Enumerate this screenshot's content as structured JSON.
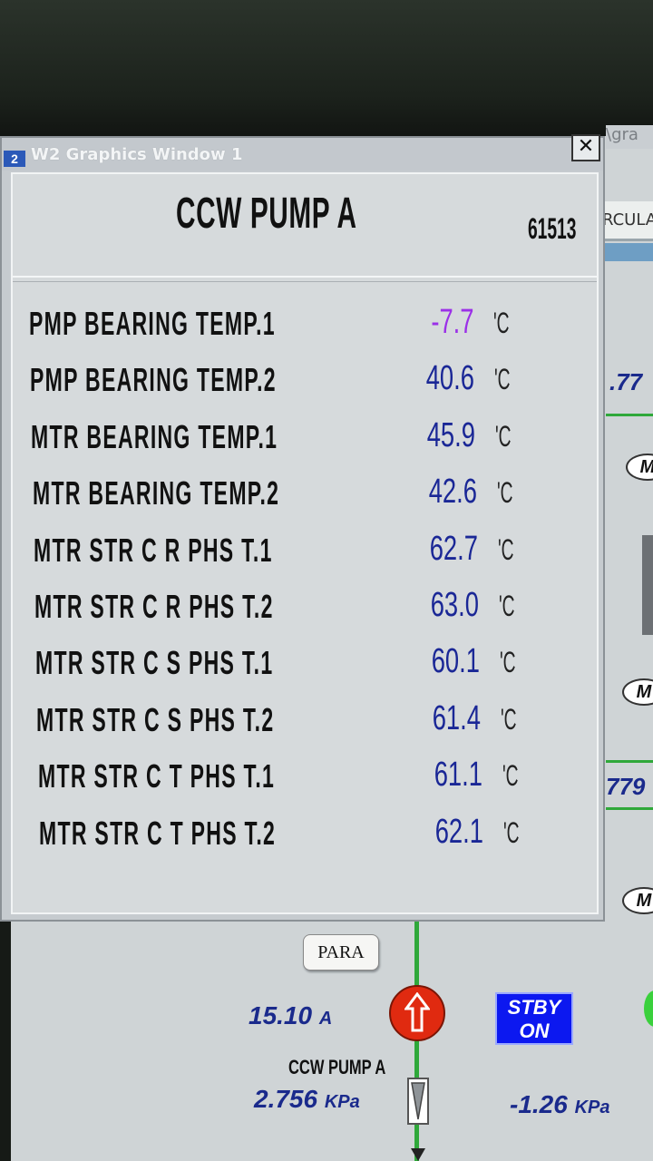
{
  "background": {
    "title_fragment": "\\gra",
    "banner_fragment": "RCULA",
    "values": [
      ".77",
      "779"
    ],
    "motor_label": "M"
  },
  "window": {
    "icon_label": "2",
    "title": "W2 Graphics Window 1",
    "close_label": "✕"
  },
  "panel": {
    "title": "CCW PUMP A",
    "id": "61513",
    "unit": "'C",
    "rows": [
      {
        "label": "PMP BEARING TEMP.1",
        "value": "-7.7",
        "color": "#9b30e8"
      },
      {
        "label": "PMP BEARING TEMP.2",
        "value": "40.6",
        "color": "#1a2796"
      },
      {
        "label": "MTR BEARING TEMP.1",
        "value": "45.9",
        "color": "#1a2796"
      },
      {
        "label": "MTR BEARING TEMP.2",
        "value": "42.6",
        "color": "#1a2796"
      },
      {
        "label": "MTR STR C R PHS T.1",
        "value": "62.7",
        "color": "#1a2796"
      },
      {
        "label": "MTR STR C R PHS T.2",
        "value": "63.0",
        "color": "#1a2796"
      },
      {
        "label": "MTR STR C S PHS T.1",
        "value": "60.1",
        "color": "#1a2796"
      },
      {
        "label": "MTR STR C S PHS T.2",
        "value": "61.4",
        "color": "#1a2796"
      },
      {
        "label": "MTR STR C T PHS T.1",
        "value": "61.1",
        "color": "#1a2796"
      },
      {
        "label": "MTR STR C T PHS T.2",
        "value": "62.1",
        "color": "#1a2796"
      }
    ]
  },
  "process": {
    "para_label": "PARA",
    "current_value": "15.10",
    "current_unit": "A",
    "standby_line1": "STBY",
    "standby_line2": "ON",
    "pump_name": "CCW PUMP A",
    "pressure1_value": "2.756",
    "pressure1_unit": "KPa",
    "pressure2_value": "-1.26",
    "pressure2_unit": "KPa",
    "pump_color": "#e02a10",
    "standby_color": "#0c18f0",
    "line_color": "#2fa83a"
  }
}
